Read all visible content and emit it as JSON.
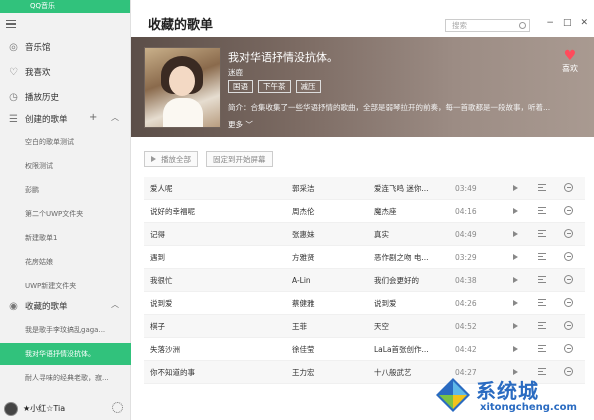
{
  "app": {
    "title": "QQ音乐"
  },
  "sidebar": {
    "nav": [
      {
        "label": "音乐馆",
        "icon": "music-hall-icon"
      },
      {
        "label": "我喜欢",
        "icon": "heart-icon"
      },
      {
        "label": "播放历史",
        "icon": "history-icon"
      }
    ],
    "created_section": {
      "label": "创建的歌单"
    },
    "created_playlists": [
      "空白的歌单测试",
      "权限测试",
      "彭鹏",
      "第二个UWP文件夹",
      "新建歌单1",
      "花房姑娘",
      "UWP新建文件夹"
    ],
    "collected_section": {
      "label": "收藏的歌单"
    },
    "collected_playlists": [
      {
        "label": "我是歌手李玟搞乱gaga..."
      },
      {
        "label": "我对华语抒情没抗体。",
        "active": true
      },
      {
        "label": "耐人寻味的经典老歌，寂..."
      }
    ],
    "user": {
      "name": "★小红☆Tia"
    }
  },
  "main": {
    "title": "收藏的歌单",
    "search_placeholder": "搜索",
    "window_controls": [
      "−",
      "□",
      "✕"
    ]
  },
  "playlist": {
    "title": "我对华语抒情没抗体。",
    "creator": "迷鹿",
    "tags": [
      "国语",
      "下午茶",
      "减压"
    ],
    "description": "简介：合集收集了一些华语抒情的歌曲，全部是弱琴拉开的前奏，每一首歌都是一段故事，听着...",
    "more_label": "更多",
    "like_label": "喜欢"
  },
  "actions": {
    "play_all": "播放全部",
    "pin_start": "固定到开始屏幕"
  },
  "songs": [
    {
      "title": "爱人呢",
      "artist": "郭采洁",
      "album": "爱连飞鸣 迷你...",
      "duration": "03:49"
    },
    {
      "title": "说好的幸福呢",
      "artist": "周杰伦",
      "album": "魔杰座",
      "duration": "04:16"
    },
    {
      "title": "记得",
      "artist": "张惠妹",
      "album": "真实",
      "duration": "04:49"
    },
    {
      "title": "遇到",
      "artist": "方雅贤",
      "album": "恶作剧之吻 电...",
      "duration": "03:29"
    },
    {
      "title": "我很忙",
      "artist": "A-Lin",
      "album": "我们会更好的",
      "duration": "04:38"
    },
    {
      "title": "说到爱",
      "artist": "蔡健雅",
      "album": "说到爱",
      "duration": "04:26"
    },
    {
      "title": "棋子",
      "artist": "王菲",
      "album": "天空",
      "duration": "04:52"
    },
    {
      "title": "失落沙洲",
      "artist": "徐佳莹",
      "album": "LaLa首张创作...",
      "duration": "04:42"
    },
    {
      "title": "你不知道的事",
      "artist": "王力宏",
      "album": "十八般武艺",
      "duration": "04:27"
    }
  ],
  "watermark": {
    "brand": "系统城",
    "domain": "xitongcheng.com"
  },
  "colors": {
    "accent": "#31c27c",
    "heart": "#ff4b5c",
    "watermark": "#2a6bc1"
  }
}
